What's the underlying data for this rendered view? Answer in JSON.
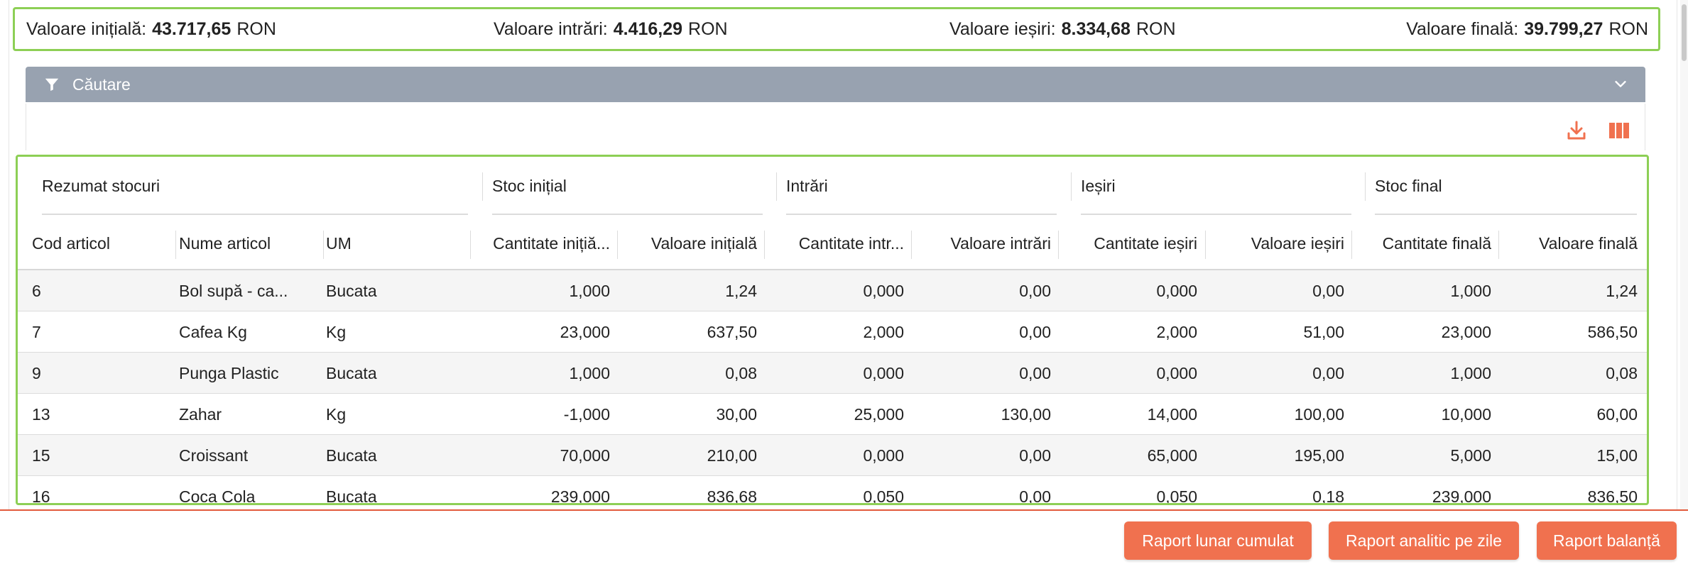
{
  "summary": {
    "initial": {
      "label": "Valoare inițială:",
      "value": "43.717,65",
      "unit": "RON"
    },
    "inputs": {
      "label": "Valoare intrări:",
      "value": "4.416,29",
      "unit": "RON"
    },
    "outputs": {
      "label": "Valoare ieșiri:",
      "value": "8.334,68",
      "unit": "RON"
    },
    "final": {
      "label": "Valoare finală:",
      "value": "39.799,27",
      "unit": "RON"
    }
  },
  "search": {
    "label": "Căutare",
    "icon": "filter-icon",
    "toggle_icon": "chevron-down-icon"
  },
  "toolbar": {
    "download_icon": "download-icon",
    "columns_icon": "columns-icon",
    "accent": "#f0714f"
  },
  "table": {
    "groups": [
      "Rezumat stocuri",
      "Stoc inițial",
      "Intrări",
      "Ieșiri",
      "Stoc final"
    ],
    "columns": [
      "Cod articol",
      "Nume articol",
      "UM",
      "Cantitate inițială",
      "Valoare inițială",
      "Cantitate intrări",
      "Valoare intrări",
      "Cantitate ieșiri",
      "Valoare ieșiri",
      "Cantitate finală",
      "Valoare finală"
    ],
    "column_display": [
      "Cod articol",
      "Nume articol",
      "UM",
      "Cantitate inițiă...",
      "Valoare inițială",
      "Cantitate intr...",
      "Valoare intrări",
      "Cantitate ieșiri",
      "Valoare ieșiri",
      "Cantitate finală",
      "Valoare finală"
    ],
    "rows": [
      {
        "cod": "6",
        "nume": "Bol supă - ca...",
        "um": "Bucata",
        "ci": "1,000",
        "vi": "1,24",
        "cin": "0,000",
        "vin": "0,00",
        "cie": "0,000",
        "vie": "0,00",
        "cf": "1,000",
        "vf": "1,24"
      },
      {
        "cod": "7",
        "nume": "Cafea Kg",
        "um": "Kg",
        "ci": "23,000",
        "vi": "637,50",
        "cin": "2,000",
        "vin": "0,00",
        "cie": "2,000",
        "vie": "51,00",
        "cf": "23,000",
        "vf": "586,50"
      },
      {
        "cod": "9",
        "nume": "Punga Plastic",
        "um": "Bucata",
        "ci": "1,000",
        "vi": "0,08",
        "cin": "0,000",
        "vin": "0,00",
        "cie": "0,000",
        "vie": "0,00",
        "cf": "1,000",
        "vf": "0,08"
      },
      {
        "cod": "13",
        "nume": "Zahar",
        "um": "Kg",
        "ci": "-1,000",
        "vi": "30,00",
        "cin": "25,000",
        "vin": "130,00",
        "cie": "14,000",
        "vie": "100,00",
        "cf": "10,000",
        "vf": "60,00"
      },
      {
        "cod": "15",
        "nume": "Croissant",
        "um": "Bucata",
        "ci": "70,000",
        "vi": "210,00",
        "cin": "0,000",
        "vin": "0,00",
        "cie": "65,000",
        "vie": "195,00",
        "cf": "5,000",
        "vf": "15,00"
      },
      {
        "cod": "16",
        "nume": "Coca Cola",
        "um": "Bucata",
        "ci": "239,000",
        "vi": "836,68",
        "cin": "0,050",
        "vin": "0,00",
        "cie": "0,050",
        "vie": "0,18",
        "cf": "239,000",
        "vf": "836,50"
      }
    ]
  },
  "buttons": {
    "monthly": "Raport lunar cumulat",
    "daily": "Raport analitic pe zile",
    "balance": "Raport balanță"
  }
}
